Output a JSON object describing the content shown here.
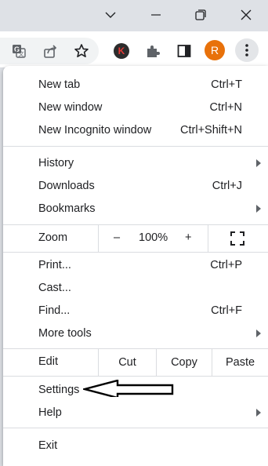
{
  "window_controls": {
    "tab_search_icon": "chevron-down-icon",
    "minimize_icon": "minimize-icon",
    "restore_icon": "restore-icon",
    "close_icon": "close-icon"
  },
  "toolbar": {
    "extension_k_letter": "K",
    "profile_initial": "R",
    "profile_color": "#e8710a"
  },
  "menu": {
    "group1": [
      {
        "label": "New tab",
        "shortcut": "Ctrl+T"
      },
      {
        "label": "New window",
        "shortcut": "Ctrl+N"
      },
      {
        "label": "New Incognito window",
        "shortcut": "Ctrl+Shift+N"
      }
    ],
    "group2": [
      {
        "label": "History",
        "has_submenu": true
      },
      {
        "label": "Downloads",
        "shortcut": "Ctrl+J"
      },
      {
        "label": "Bookmarks",
        "has_submenu": true
      }
    ],
    "zoom": {
      "label": "Zoom",
      "minus": "–",
      "value": "100%",
      "plus": "+",
      "fullscreen_icon": "fullscreen-icon"
    },
    "group3": [
      {
        "label": "Print...",
        "shortcut": "Ctrl+P"
      },
      {
        "label": "Cast..."
      },
      {
        "label": "Find...",
        "shortcut": "Ctrl+F"
      },
      {
        "label": "More tools",
        "has_submenu": true
      }
    ],
    "edit": {
      "label": "Edit",
      "cut": "Cut",
      "copy": "Copy",
      "paste": "Paste"
    },
    "group4": [
      {
        "label": "Settings"
      },
      {
        "label": "Help",
        "has_submenu": true
      }
    ],
    "exit": {
      "label": "Exit"
    }
  },
  "annotation": {
    "icon": "left-arrow-annotation-icon"
  }
}
